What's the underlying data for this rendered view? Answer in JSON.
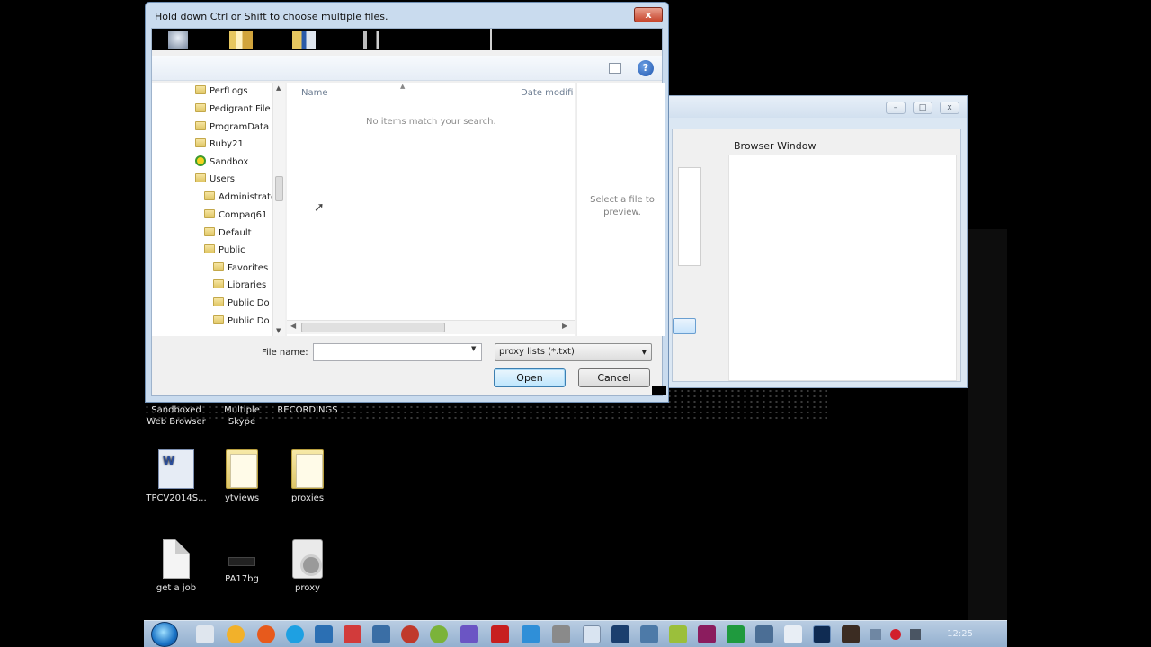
{
  "dialog": {
    "title": "Hold down Ctrl or Shift to choose multiple files.",
    "close_symbol": "x",
    "help_symbol": "?",
    "nav_items": [
      "PerfLogs",
      "Pedigrant File",
      "ProgramData",
      "Ruby21",
      "Sandbox",
      "Users",
      "Administrator",
      "Compaq61",
      "Default",
      "Public",
      "Favorites",
      "Libraries",
      "Public Do",
      "Public Do"
    ],
    "columns": {
      "name": "Name",
      "date_modified": "Date modifi"
    },
    "empty_message": "No items match your search.",
    "preview_message": "Select a file to preview.",
    "file_name_label": "File name:",
    "file_name_value": "",
    "file_type_selected": "proxy lists (*.txt)",
    "open_button": "Open",
    "cancel_button": "Cancel"
  },
  "background_window": {
    "browser_label": "Browser Window"
  },
  "desktop": {
    "top_row_labels": [
      {
        "line1": "Sandboxed",
        "line2": "Web Browser"
      },
      {
        "line1": "Multiple",
        "line2": "Skype"
      },
      {
        "line1": "RECORDINGS",
        "line2": ""
      }
    ],
    "icons": [
      {
        "label": "TPCV2014S...",
        "icon": "word-document-icon"
      },
      {
        "label": "ytviews",
        "icon": "folder-icon"
      },
      {
        "label": "proxies",
        "icon": "folder-icon"
      },
      {
        "label": "get a job",
        "icon": "text-file-icon"
      },
      {
        "label": "PA17bg",
        "icon": "image-icon"
      },
      {
        "label": "proxy",
        "icon": "settings-file-icon"
      }
    ]
  },
  "taskbar": {
    "clock": "12:25"
  },
  "colors": {
    "dialog_frame": "#c9dbee",
    "close_red": "#c7452c",
    "taskbar": "#93b0cf",
    "desktop": "#000000"
  }
}
